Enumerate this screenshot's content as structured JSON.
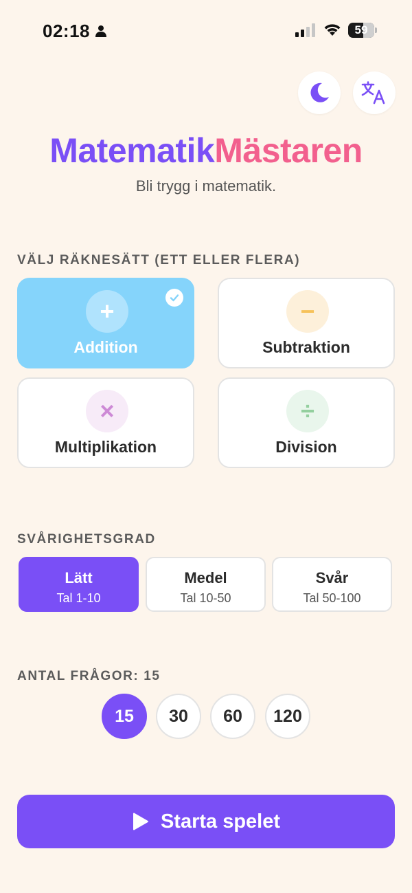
{
  "status_bar": {
    "time": "02:18",
    "battery_percent": 59,
    "battery_label": "59"
  },
  "header": {
    "theme_toggle_icon": "moon-icon",
    "language_icon": "translate-icon"
  },
  "title": {
    "part1": "Matematik",
    "part2": "Mästaren",
    "subtitle": "Bli trygg i matematik."
  },
  "operations": {
    "label": "VÄLJ RÄKNESÄTT (ETT ELLER FLERA)",
    "items": [
      {
        "label": "Addition",
        "symbol": "+",
        "selected": true,
        "icon_bg": "#b0e3fd",
        "icon_color": "#ffffff"
      },
      {
        "label": "Subtraktion",
        "symbol": "−",
        "selected": false,
        "icon_bg": "#fdf0da",
        "icon_color": "#f6c25a"
      },
      {
        "label": "Multiplikation",
        "symbol": "×",
        "selected": false,
        "icon_bg": "#f7ebf8",
        "icon_color": "#cd8ad6"
      },
      {
        "label": "Division",
        "symbol": "÷",
        "selected": false,
        "icon_bg": "#e9f6ec",
        "icon_color": "#93cf9e"
      }
    ]
  },
  "difficulty": {
    "label": "SVÅRIGHETSGRAD",
    "options": [
      {
        "name": "Lätt",
        "range": "Tal 1-10",
        "selected": true
      },
      {
        "name": "Medel",
        "range": "Tal 10-50",
        "selected": false
      },
      {
        "name": "Svår",
        "range": "Tal 50-100",
        "selected": false
      }
    ]
  },
  "questions": {
    "label": "ANTAL FRÅGOR: 15",
    "options": [
      "15",
      "30",
      "60",
      "120"
    ],
    "selected": "15"
  },
  "start": {
    "label": "Starta spelet"
  },
  "colors": {
    "background": "#fdf5ec",
    "accent": "#7a4ff6",
    "pink": "#f2608e",
    "selected_operation": "#85d4fb"
  }
}
